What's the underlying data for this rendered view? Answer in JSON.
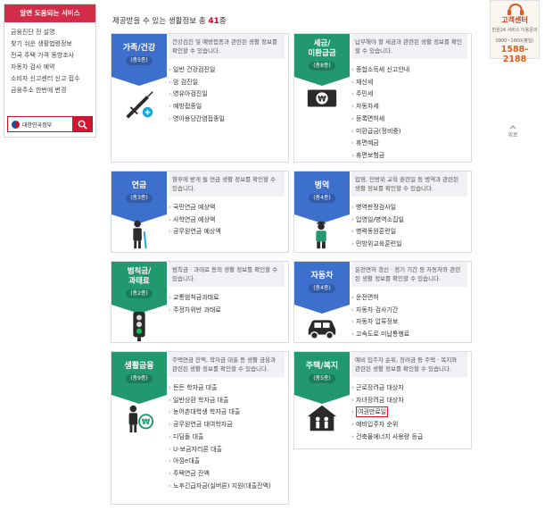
{
  "sidebar": {
    "title": "알면 도움되는 서비스",
    "items": [
      "금융진단 전 설명",
      "찾기 쉬운 생활법령정보",
      "전국 주택 가격 동향조사",
      "자동차 검사 예약",
      "소비자 신고센터 신고 접수",
      "금융주소 한번에 변경"
    ],
    "gov_banner": "대한민국정부"
  },
  "callcenter": {
    "title": "고객센터",
    "sub": "민원24 서비스 이용문의",
    "hours": "0900~1800(평일)",
    "phone": "1588-2188"
  },
  "top_link": "위로",
  "main": {
    "title_prefix": "제공받을 수 있는 생활정보 총 ",
    "count": "41",
    "title_suffix": "종"
  },
  "colors": {
    "blue": "#3d6fcc",
    "green": "#21986d",
    "highlight": "#e0141e",
    "title_count": "#d0021b"
  },
  "categories": [
    {
      "name1": "가족/건강",
      "name2": "",
      "count": "(총5종)",
      "desc": "건강검진 및 예방접종과 관련된 생활 정보를 확인할 수 있습니다.",
      "items": [
        "일반 건강검진일",
        "암 검진일",
        "영유아검진일",
        "예방접종일",
        "영아용당간염접종일"
      ]
    },
    {
      "name1": "세금/",
      "name2": "미환급금",
      "count": "(총8종)",
      "desc": "납부해야 할 세금과 관련된 생활 정보를 확인할 수 있습니다.",
      "items": [
        "종합소득세 신고안내",
        "재산세",
        "주민세",
        "자동차세",
        "등록면허세",
        "미환급금(정비중)",
        "휴면예금",
        "휴면보험금"
      ]
    },
    {
      "name1": "연금",
      "name2": "",
      "count": "(총3종)",
      "desc": "향후에 받게 될 연금 생활 정보를 확인할 수 있습니다.",
      "items": [
        "국민연금 예상액",
        "사학연금 예상액",
        "공무원연금 예상액"
      ]
    },
    {
      "name1": "병역",
      "name2": "",
      "count": "(총4종)",
      "desc": "입영, 민방위 교육 훈련일 등 병역과 관련된 생활 정보를 확인할 수 있습니다.",
      "items": [
        "병역판정검사일",
        "입영일/병역소집일",
        "병력동원훈련일",
        "민방위교육훈련일"
      ]
    },
    {
      "name1": "범칙금/",
      "name2": "과태료",
      "count": "(총2종)",
      "desc": "범칙금 · 과태료 등의 생활 정보를 확인할 수 있습니다.",
      "items": [
        "교통범칙금과태료",
        "주정차위반 과태료"
      ]
    },
    {
      "name1": "자동차",
      "name2": "",
      "count": "(총4종)",
      "desc": "운전면허 갱신 · 정기 기간 등 자동차와 관련된 생활 정보를 확인할 수 있습니다.",
      "items": [
        "운전면허",
        "자동차 검사기간",
        "자동차 압류정보",
        "고속도로 미납통행료"
      ]
    },
    {
      "name1": "생활금융",
      "name2": "",
      "count": "(총9종)",
      "desc": "주택연금 잔액, 학자금 대출 등 생활 금융과 관련된 생활 정보를 확인할 수 있습니다.",
      "items": [
        "든든 학자금 대출",
        "일반상환 학자금 대출",
        "농어촌대학생 학자금 대출",
        "공무원연금 대여학자금",
        "디딤돌 대출",
        "U-보금자리론 대출",
        "아낌e대출",
        "주택연금 잔액",
        "노후긴급자금(실버론) 지원(대출잔액)"
      ]
    },
    {
      "name1": "주택/복지",
      "name2": "",
      "count": "(총5종)",
      "desc": "예비 입주자 순위, 장려금 등 주택 · 복지와 관련된 생활 정보를 확인할 수 있습니다.",
      "items": [
        "근로장려금 대상자",
        "자녀장려금 대상자",
        "여권만료일",
        "예비입주자 순위",
        "건축물에너지 사용량 등급"
      ]
    }
  ]
}
